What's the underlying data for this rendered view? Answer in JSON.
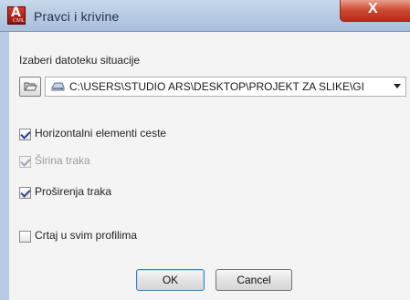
{
  "window": {
    "title": "Pravci i krivine",
    "app_icon_letter": "A",
    "app_icon_small": "CIVIL",
    "close_symbol": "X"
  },
  "file_section": {
    "label": "Izaberi datoteku situacije",
    "path": "C:\\USERS\\STUDIO ARS\\DESKTOP\\PROJEKT ZA SLIKE\\GI",
    "browse_icon": "folder-open-icon",
    "drive_icon": "drive-icon",
    "dropdown_icon": "chevron-down-icon"
  },
  "options": {
    "horizontal": {
      "label": "Horizontalni elementi ceste",
      "checked": true,
      "enabled": true
    },
    "width": {
      "label": "Širina traka",
      "checked": true,
      "enabled": false
    },
    "widening": {
      "label": "Proširenja traka",
      "checked": true,
      "enabled": true
    },
    "draw_all": {
      "label": "Crtaj u svim profilima",
      "checked": false,
      "enabled": true
    }
  },
  "buttons": {
    "ok": "OK",
    "cancel": "Cancel"
  },
  "colors": {
    "titlebar": "#b8cbe2",
    "close_button": "#cc4b31",
    "check_mark": "#2c3f90",
    "default_button_border": "#3c7fb1"
  }
}
